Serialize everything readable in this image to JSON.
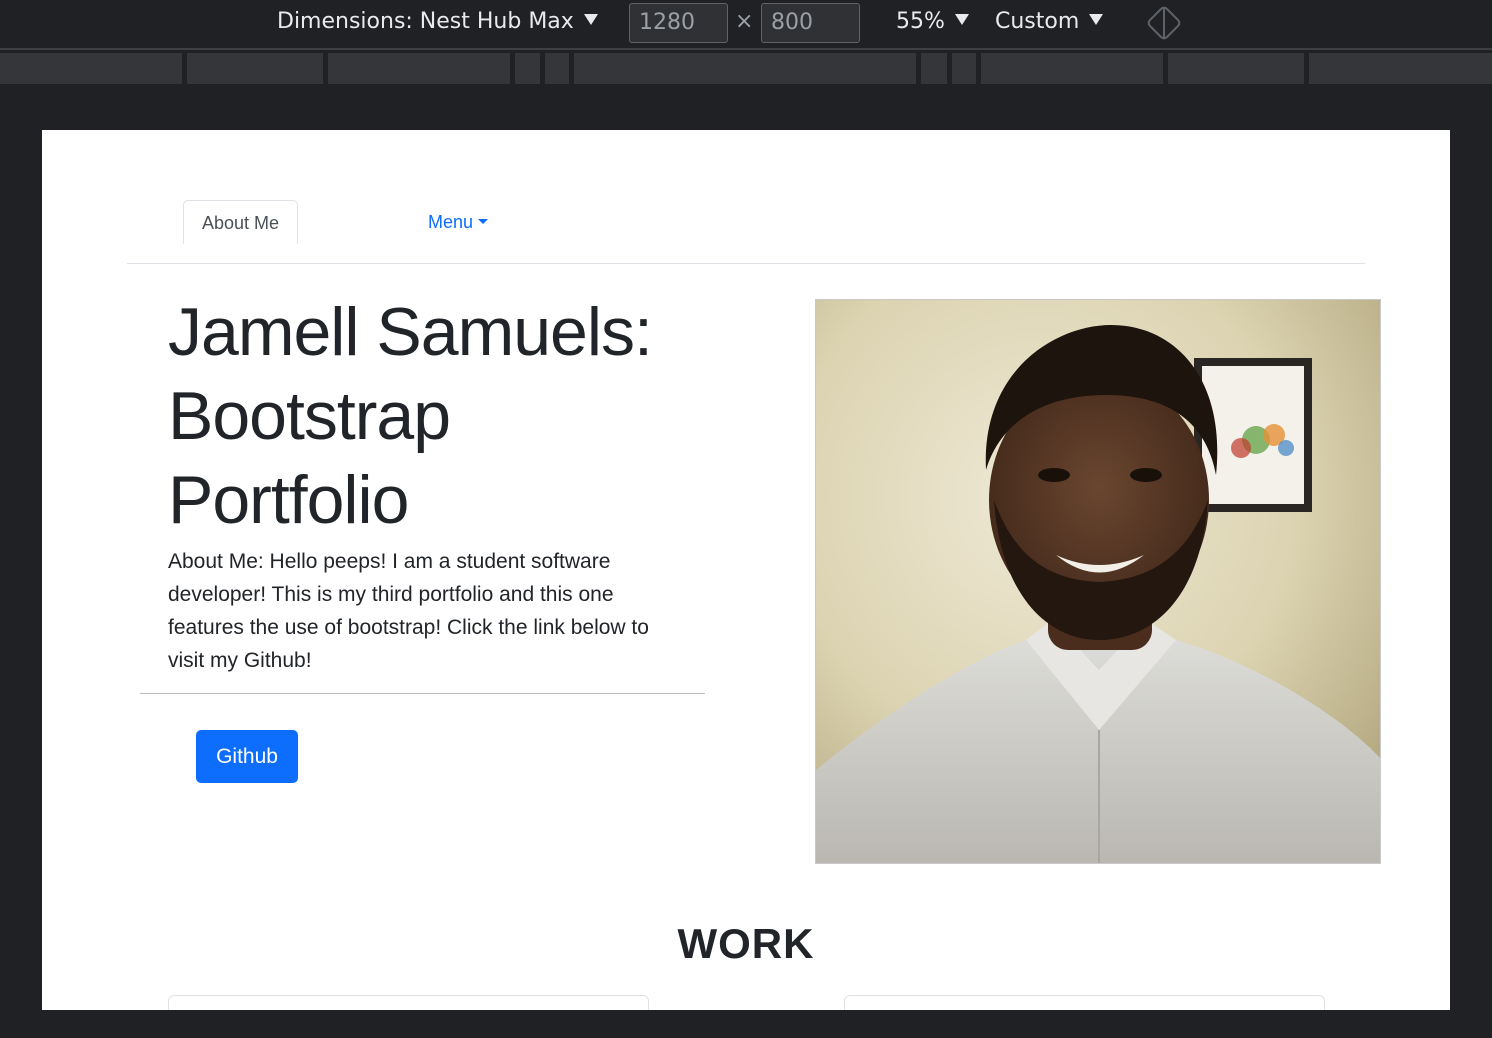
{
  "devtools": {
    "device_label": "Dimensions: Nest Hub Max",
    "width_value": "1280",
    "height_value": "800",
    "times_symbol": "×",
    "zoom": "55%",
    "throttle": "Custom"
  },
  "nav": {
    "tab_active": "About Me",
    "menu_label": "Menu"
  },
  "hero": {
    "title": "Jamell Samuels: Bootstrap Portfolio",
    "about": "About Me: Hello peeps! I am a student software developer! This is my third portfolio and this one features the use of bootstrap! Click the link below to visit my Github!",
    "button": "Github"
  },
  "work": {
    "title": "WORK"
  }
}
